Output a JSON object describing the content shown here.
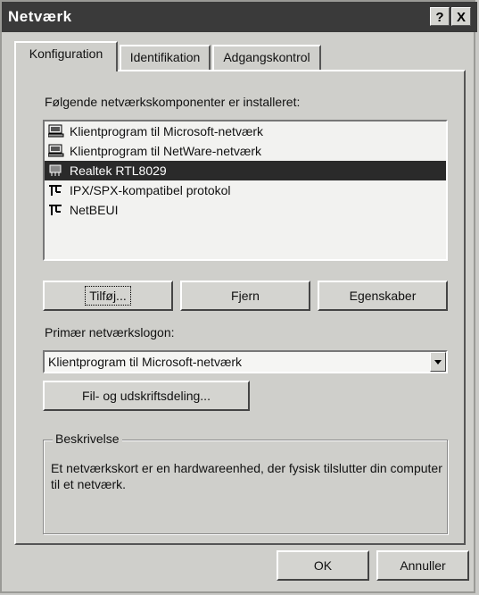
{
  "window": {
    "title": "Netværk",
    "help_button": "?",
    "close_button": "X"
  },
  "tabs": [
    {
      "label": "Konfiguration",
      "active": true
    },
    {
      "label": "Identifikation",
      "active": false
    },
    {
      "label": "Adgangskontrol",
      "active": false
    }
  ],
  "components": {
    "label": "Følgende netværkskomponenter er installeret:",
    "items": [
      {
        "label": "Klientprogram til Microsoft-netværk",
        "icon": "network-client-icon",
        "selected": false
      },
      {
        "label": "Klientprogram til NetWare-netværk",
        "icon": "network-client-icon",
        "selected": false
      },
      {
        "label": "Realtek RTL8029",
        "icon": "network-adapter-icon",
        "selected": true
      },
      {
        "label": "IPX/SPX-kompatibel protokol",
        "icon": "protocol-icon",
        "selected": false
      },
      {
        "label": "NetBEUI",
        "icon": "protocol-icon",
        "selected": false
      }
    ]
  },
  "buttons": {
    "add": "Tilføj...",
    "remove": "Fjern",
    "properties": "Egenskaber",
    "file_print_sharing": "Fil- og udskriftsdeling...",
    "ok": "OK",
    "cancel": "Annuller"
  },
  "logon": {
    "label": "Primær netværkslogon:",
    "value": "Klientprogram til Microsoft-netværk"
  },
  "description": {
    "legend": "Beskrivelse",
    "text": "Et netværkskort er en hardwareenhed, der fysisk tilslutter din computer til et netværk."
  }
}
